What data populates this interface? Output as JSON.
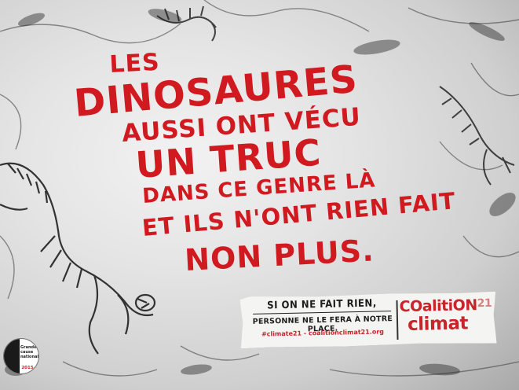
{
  "headline": {
    "line1": "LES",
    "line2": "DINOSAURES",
    "line3": "AUSSI ONT VÉCU",
    "line4": "UN TRUC",
    "line5": "DANS CE GENRE LÀ",
    "line6": "ET ILS N'ONT RIEN FAIT",
    "line7": "NON PLUS."
  },
  "note": {
    "slogan_top": "SI ON NE FAIT RIEN,",
    "slogan_bottom": "PERSONNE NE LE FERA À NOTRE PLACE.",
    "hashtags": "#climate21  -  coalitionclimat21.org"
  },
  "logo": {
    "word1": "COalitiON",
    "number": "21",
    "word2": "climat"
  },
  "badge": {
    "text": "Grande cause nationale",
    "year": "2015"
  },
  "colors": {
    "headline_red": "#d01a1f",
    "logo_red": "#c9242a",
    "stone_light": "#f2f2f2",
    "stone_dark": "#a9a9a9"
  }
}
